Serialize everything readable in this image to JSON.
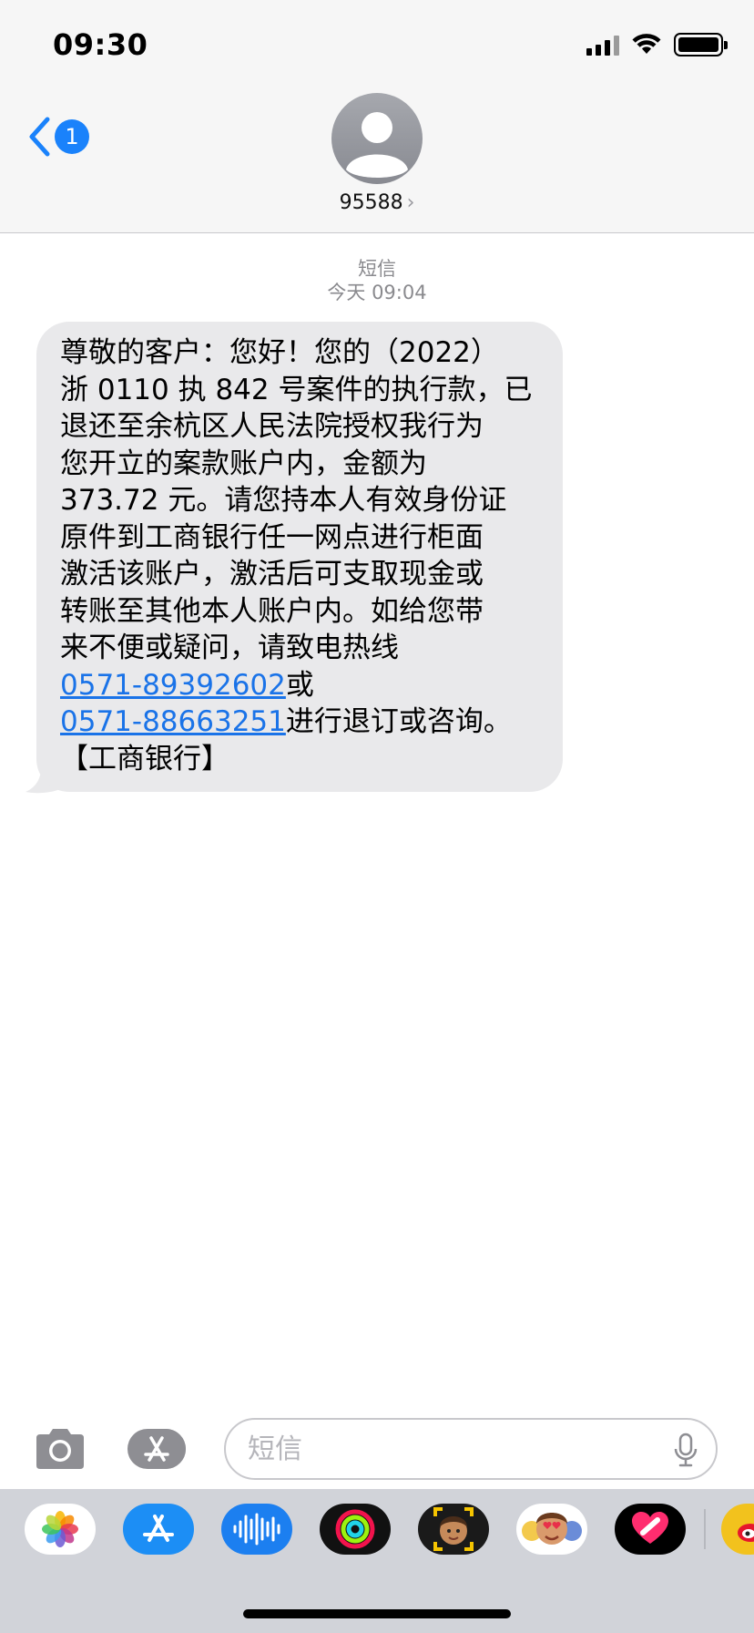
{
  "status_bar": {
    "time": "09:30"
  },
  "header": {
    "back_badge": "1",
    "contact_name": "95588",
    "chevron": "›"
  },
  "conversation": {
    "service_label": "短信",
    "timestamp": "今天 09:04",
    "message": {
      "text_before": "尊敬的客户：您好！您的（2022）\n浙 0110 执 842 号案件的执行款，已\n退还至余杭区人民法院授权我行为\n您开立的案款账户内，金额为\n373.72 元。请您持本人有效身份证\n原件到工商银行任一网点进行柜面\n激活该账户，激活后可支取现金或\n转账至其他本人账户内。如给您带\n来不便或疑问，请致电热线\n",
      "phone1": "0571-89392602",
      "text_middle": "或\n",
      "phone2": "0571-88663251",
      "text_after": "进行退订或咨询。\n【工商银行】"
    }
  },
  "input_bar": {
    "placeholder": "短信"
  },
  "app_drawer": {
    "apps": [
      {
        "name": "photos-icon"
      },
      {
        "name": "app-store-icon"
      },
      {
        "name": "audio-message-icon"
      },
      {
        "name": "fitness-icon"
      },
      {
        "name": "memoji-icon"
      },
      {
        "name": "memoji-stickers-icon"
      },
      {
        "name": "digital-touch-icon"
      },
      {
        "name": "weibo-icon"
      }
    ]
  },
  "colors": {
    "accent": "#1a82fb",
    "bubble": "#e9e9eb",
    "link": "#1a73e8"
  }
}
